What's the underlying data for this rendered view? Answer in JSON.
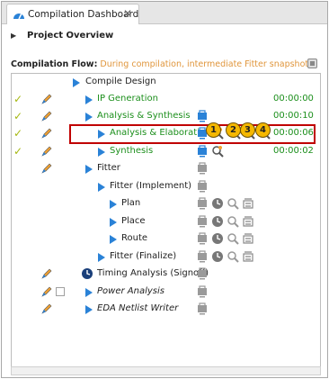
{
  "tab": {
    "title": "Compilation Dashboard",
    "close": "✕",
    "icon": "dashboard-icon"
  },
  "overview": {
    "arrow": "▶",
    "label": "Project Overview"
  },
  "flow": {
    "label": "Compilation Flow:",
    "note": " During compilation, intermediate Fitter snapshots (planned"
  },
  "rows": [
    {
      "label": "Compile Design",
      "time": "",
      "status": "none"
    },
    {
      "label": "IP Generation",
      "time": "00:00:00",
      "status": "done"
    },
    {
      "label": "Analysis & Synthesis",
      "time": "00:00:10",
      "status": "done"
    },
    {
      "label": "Analysis & Elaboration",
      "time": "00:00:06",
      "status": "done"
    },
    {
      "label": "Synthesis",
      "time": "00:00:02",
      "status": "done"
    },
    {
      "label": "Fitter",
      "time": "",
      "status": "none"
    },
    {
      "label": "Fitter (Implement)",
      "time": "",
      "status": "none"
    },
    {
      "label": "Plan",
      "time": "",
      "status": "none"
    },
    {
      "label": "Place",
      "time": "",
      "status": "none"
    },
    {
      "label": "Route",
      "time": "",
      "status": "none"
    },
    {
      "label": "Fitter (Finalize)",
      "time": "",
      "status": "none"
    },
    {
      "label": "Timing Analysis (Signoff)",
      "time": "",
      "status": "none"
    },
    {
      "label": "Power Analysis",
      "time": "",
      "status": "none"
    },
    {
      "label": "EDA Netlist Writer",
      "time": "",
      "status": "none"
    }
  ],
  "badges": [
    "1",
    "2",
    "3",
    "4"
  ],
  "check_glyph": "✓",
  "colors": {
    "accent": "#2a82d7",
    "done_green": "#1c8f1c",
    "badge": "#f5b800",
    "highlight": "#c00000",
    "note": "#e0963c",
    "check": "#a6b813"
  }
}
